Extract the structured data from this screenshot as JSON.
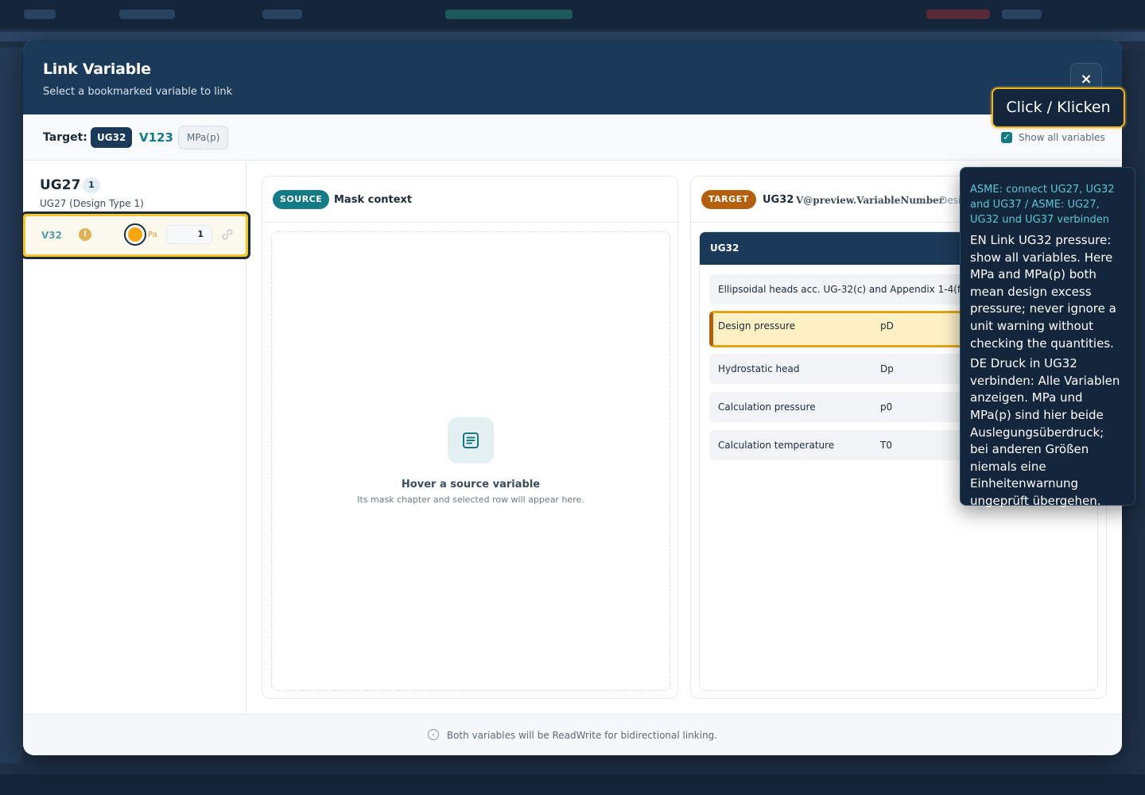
{
  "modal": {
    "title": "Link Variable",
    "subtitle": "Select a bookmarked variable to link",
    "close_label": "×"
  },
  "target_bar": {
    "label": "Target:",
    "chapter": "UG32",
    "variable": "V123",
    "unit": "MPa(p)",
    "show_all_label": "Show all variables",
    "show_all_checked": true,
    "check_mark": "✓"
  },
  "source_list": {
    "group_title": "UG27",
    "group_count": "1",
    "group_subtitle": "UG27 (Design Type 1)",
    "items": [
      {
        "name": "V32",
        "warning": "!",
        "unit": "Pa",
        "quantity": "1"
      }
    ]
  },
  "source_card": {
    "pill": "SOURCE",
    "title": "Mask context",
    "empty_title": "Hover a source variable",
    "empty_subtitle": "Its mask chapter and selected row will appear here."
  },
  "target_card": {
    "pill": "TARGET",
    "chapter": "UG32",
    "variable_ref": "V@preview.VariableNumber",
    "description": "Desig",
    "mask_title": "UG32",
    "rows": [
      {
        "label": "Ellipsoidal heads acc. UG-32(c) and Appendix 1-4(f)",
        "symbol": ""
      },
      {
        "label": "Design pressure",
        "symbol": "pD",
        "active": true
      },
      {
        "label": "Hydrostatic head",
        "symbol": "Dp"
      },
      {
        "label": "Calculation pressure",
        "symbol": "p0"
      },
      {
        "label": "Calculation temperature",
        "symbol": "T0"
      }
    ]
  },
  "footer": {
    "note": "Both variables will be ReadWrite for bidirectional linking."
  },
  "callout": {
    "label": "Click / Klicken"
  },
  "tooltip": {
    "heading": "ASME: connect UG27, UG32 and UG37 / ASME: UG27, UG32 und UG37 verbinden",
    "en": "EN Link UG32 pressure: show all variables. Here MPa and MPa(p) both mean design excess pressure; never ignore a unit warning without checking the quantities.",
    "de": "DE Druck in UG32 verbinden: Alle Variablen anzeigen. MPa und MPa(p) sind hier beide Auslegungsüberdruck; bei anderen Größen niemals eine Einheitenwarnung ungeprüft übergehen."
  },
  "colors": {
    "header_navy": "#1b3a59",
    "accent_teal": "#147a86",
    "target_orange": "#b25f0e",
    "highlight_yellow": "#f3c72c"
  },
  "icons": {
    "close": "close-icon",
    "check": "check-icon",
    "warning": "warning-icon",
    "link": "link-icon",
    "document": "document-icon",
    "info": "info-icon"
  }
}
